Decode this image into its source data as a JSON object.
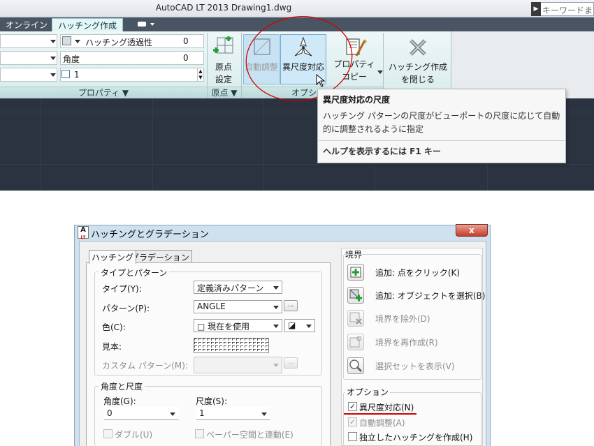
{
  "app": {
    "title": "AutoCAD LT 2013    Drawing1.dwg",
    "search_placeholder": "キーワードまた"
  },
  "ribbon": {
    "tabs": [
      "オンライン",
      "ハッチング作成"
    ],
    "properties_panel": {
      "transparency_label": "ハッチング透過性",
      "transparency_value": "0",
      "angle_label": "角度",
      "angle_value": "0",
      "scale_value": "1",
      "footer": "プロパティ ▼"
    },
    "origin_panel": {
      "set_origin_label": "原点\n設定",
      "set_origin_line1": "原点",
      "set_origin_line2": "設定",
      "footer": "原点 ▼"
    },
    "options_panel": {
      "associative_label": "自動調整",
      "annotative_label": "異尺度対応",
      "match_props_line1": "プロパティ",
      "match_props_line2": "コピー",
      "footer": "オプション"
    },
    "close_panel": {
      "close_line1": "ハッチング作成",
      "close_line2": "を閉じる"
    }
  },
  "tooltip": {
    "title": "異尺度対応の尺度",
    "body_line1": "ハッチング パターンの尺度がビューポートの尺度に応じて自動",
    "body_line2": "的に調整されるように指定",
    "help": "ヘルプを表示するには F1 キー"
  },
  "dialog": {
    "title": "ハッチングとグラデーション",
    "close": "x",
    "tabs": [
      "ハッチング",
      "グラデーション"
    ],
    "type_pattern": {
      "group_title": "タイプとパターン",
      "type_label": "タイプ(Y):",
      "type_value": "定義済みパターン",
      "pattern_label": "パターン(P):",
      "pattern_value": "ANGLE",
      "color_label": "色(C):",
      "color_value": "□ 現在を使用",
      "color_bg_value": "◪",
      "swatch_label": "見本:",
      "custom_label": "カスタム パターン(M):",
      "ellipsis": "..."
    },
    "angle_scale": {
      "group_title": "角度と尺度",
      "angle_label": "角度(G):",
      "angle_value": "0",
      "scale_label": "尺度(S):",
      "scale_value": "1",
      "double_label": "ダブル(U)",
      "paper_label": "ペーパー空間と連動(E)"
    },
    "boundaries": {
      "title": "境界",
      "add_pick": "追加: 点をクリック(K)",
      "add_select": "追加: オブジェクトを選択(B)",
      "remove": "境界を除外(D)",
      "recreate": "境界を再作成(R)",
      "view_sel": "選択セットを表示(V)"
    },
    "options": {
      "title": "オプション",
      "annotative": "異尺度対応(N)",
      "associative": "自動調整(A)",
      "separate": "独立したハッチングを作成(H)"
    }
  },
  "colors": {
    "accent_red": "#d10000",
    "ribbon_bg": "#e3f2f2",
    "workspace": "#2b3340"
  }
}
